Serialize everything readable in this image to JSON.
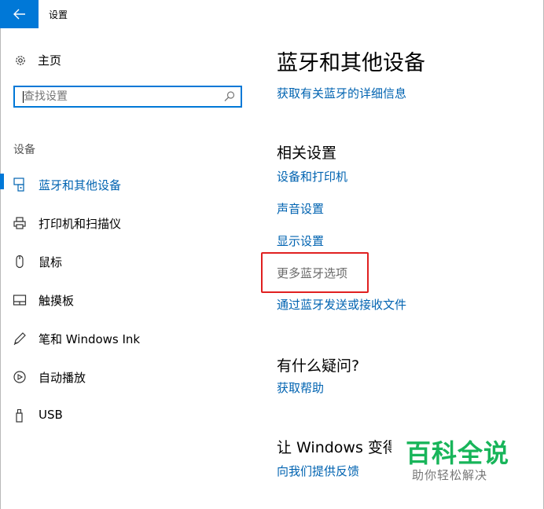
{
  "window": {
    "title": "设置"
  },
  "sidebar": {
    "home_label": "主页",
    "search_placeholder": "查找设置",
    "section_label": "设备",
    "items": [
      {
        "label": "蓝牙和其他设备",
        "icon": "bluetooth-devices-icon",
        "active": true
      },
      {
        "label": "打印机和扫描仪",
        "icon": "printer-icon",
        "active": false
      },
      {
        "label": "鼠标",
        "icon": "mouse-icon",
        "active": false
      },
      {
        "label": "触摸板",
        "icon": "touchpad-icon",
        "active": false
      },
      {
        "label": "笔和 Windows Ink",
        "icon": "pen-icon",
        "active": false
      },
      {
        "label": "自动播放",
        "icon": "autoplay-icon",
        "active": false
      },
      {
        "label": "USB",
        "icon": "usb-icon",
        "active": false
      }
    ]
  },
  "main": {
    "title": "蓝牙和其他设备",
    "bluetooth_info_link": "获取有关蓝牙的详细信息",
    "related_heading": "相关设置",
    "related_links": [
      "设备和打印机",
      "声音设置",
      "显示设置",
      "更多蓝牙选项",
      "通过蓝牙发送或接收文件"
    ],
    "question_heading": "有什么疑问?",
    "help_link": "获取帮助",
    "improve_heading": "让 Windows 变得更好",
    "feedback_link": "向我们提供反馈"
  },
  "watermark": {
    "main": "百科全说",
    "sub": "助你轻松解决"
  },
  "colors": {
    "accent": "#0078d7",
    "link": "#0063b1",
    "highlight": "#e02020",
    "watermark": "#18b55a"
  }
}
